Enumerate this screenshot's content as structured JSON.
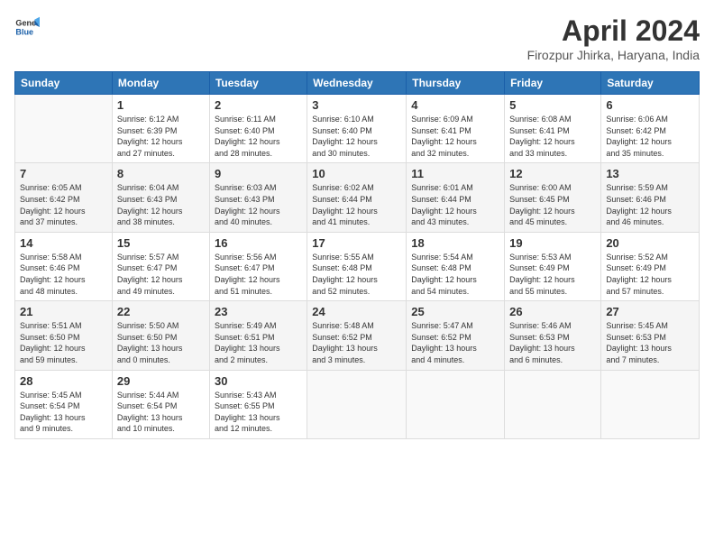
{
  "header": {
    "logo_general": "General",
    "logo_blue": "Blue",
    "title": "April 2024",
    "subtitle": "Firozpur Jhirka, Haryana, India"
  },
  "weekdays": [
    "Sunday",
    "Monday",
    "Tuesday",
    "Wednesday",
    "Thursday",
    "Friday",
    "Saturday"
  ],
  "weeks": [
    [
      {
        "day": "",
        "info": ""
      },
      {
        "day": "1",
        "info": "Sunrise: 6:12 AM\nSunset: 6:39 PM\nDaylight: 12 hours\nand 27 minutes."
      },
      {
        "day": "2",
        "info": "Sunrise: 6:11 AM\nSunset: 6:40 PM\nDaylight: 12 hours\nand 28 minutes."
      },
      {
        "day": "3",
        "info": "Sunrise: 6:10 AM\nSunset: 6:40 PM\nDaylight: 12 hours\nand 30 minutes."
      },
      {
        "day": "4",
        "info": "Sunrise: 6:09 AM\nSunset: 6:41 PM\nDaylight: 12 hours\nand 32 minutes."
      },
      {
        "day": "5",
        "info": "Sunrise: 6:08 AM\nSunset: 6:41 PM\nDaylight: 12 hours\nand 33 minutes."
      },
      {
        "day": "6",
        "info": "Sunrise: 6:06 AM\nSunset: 6:42 PM\nDaylight: 12 hours\nand 35 minutes."
      }
    ],
    [
      {
        "day": "7",
        "info": "Sunrise: 6:05 AM\nSunset: 6:42 PM\nDaylight: 12 hours\nand 37 minutes."
      },
      {
        "day": "8",
        "info": "Sunrise: 6:04 AM\nSunset: 6:43 PM\nDaylight: 12 hours\nand 38 minutes."
      },
      {
        "day": "9",
        "info": "Sunrise: 6:03 AM\nSunset: 6:43 PM\nDaylight: 12 hours\nand 40 minutes."
      },
      {
        "day": "10",
        "info": "Sunrise: 6:02 AM\nSunset: 6:44 PM\nDaylight: 12 hours\nand 41 minutes."
      },
      {
        "day": "11",
        "info": "Sunrise: 6:01 AM\nSunset: 6:44 PM\nDaylight: 12 hours\nand 43 minutes."
      },
      {
        "day": "12",
        "info": "Sunrise: 6:00 AM\nSunset: 6:45 PM\nDaylight: 12 hours\nand 45 minutes."
      },
      {
        "day": "13",
        "info": "Sunrise: 5:59 AM\nSunset: 6:46 PM\nDaylight: 12 hours\nand 46 minutes."
      }
    ],
    [
      {
        "day": "14",
        "info": "Sunrise: 5:58 AM\nSunset: 6:46 PM\nDaylight: 12 hours\nand 48 minutes."
      },
      {
        "day": "15",
        "info": "Sunrise: 5:57 AM\nSunset: 6:47 PM\nDaylight: 12 hours\nand 49 minutes."
      },
      {
        "day": "16",
        "info": "Sunrise: 5:56 AM\nSunset: 6:47 PM\nDaylight: 12 hours\nand 51 minutes."
      },
      {
        "day": "17",
        "info": "Sunrise: 5:55 AM\nSunset: 6:48 PM\nDaylight: 12 hours\nand 52 minutes."
      },
      {
        "day": "18",
        "info": "Sunrise: 5:54 AM\nSunset: 6:48 PM\nDaylight: 12 hours\nand 54 minutes."
      },
      {
        "day": "19",
        "info": "Sunrise: 5:53 AM\nSunset: 6:49 PM\nDaylight: 12 hours\nand 55 minutes."
      },
      {
        "day": "20",
        "info": "Sunrise: 5:52 AM\nSunset: 6:49 PM\nDaylight: 12 hours\nand 57 minutes."
      }
    ],
    [
      {
        "day": "21",
        "info": "Sunrise: 5:51 AM\nSunset: 6:50 PM\nDaylight: 12 hours\nand 59 minutes."
      },
      {
        "day": "22",
        "info": "Sunrise: 5:50 AM\nSunset: 6:50 PM\nDaylight: 13 hours\nand 0 minutes."
      },
      {
        "day": "23",
        "info": "Sunrise: 5:49 AM\nSunset: 6:51 PM\nDaylight: 13 hours\nand 2 minutes."
      },
      {
        "day": "24",
        "info": "Sunrise: 5:48 AM\nSunset: 6:52 PM\nDaylight: 13 hours\nand 3 minutes."
      },
      {
        "day": "25",
        "info": "Sunrise: 5:47 AM\nSunset: 6:52 PM\nDaylight: 13 hours\nand 4 minutes."
      },
      {
        "day": "26",
        "info": "Sunrise: 5:46 AM\nSunset: 6:53 PM\nDaylight: 13 hours\nand 6 minutes."
      },
      {
        "day": "27",
        "info": "Sunrise: 5:45 AM\nSunset: 6:53 PM\nDaylight: 13 hours\nand 7 minutes."
      }
    ],
    [
      {
        "day": "28",
        "info": "Sunrise: 5:45 AM\nSunset: 6:54 PM\nDaylight: 13 hours\nand 9 minutes."
      },
      {
        "day": "29",
        "info": "Sunrise: 5:44 AM\nSunset: 6:54 PM\nDaylight: 13 hours\nand 10 minutes."
      },
      {
        "day": "30",
        "info": "Sunrise: 5:43 AM\nSunset: 6:55 PM\nDaylight: 13 hours\nand 12 minutes."
      },
      {
        "day": "",
        "info": ""
      },
      {
        "day": "",
        "info": ""
      },
      {
        "day": "",
        "info": ""
      },
      {
        "day": "",
        "info": ""
      }
    ]
  ]
}
